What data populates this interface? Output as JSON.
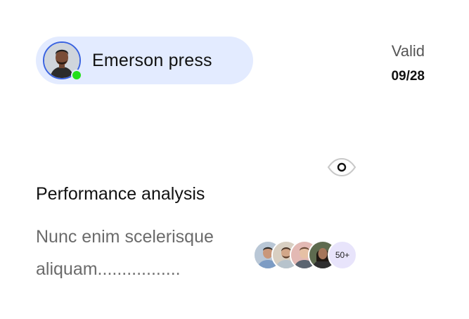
{
  "user": {
    "name": "Emerson press",
    "status": "online",
    "avatar_icon": "user-avatar"
  },
  "validity": {
    "label": "Valid",
    "date": "09/28"
  },
  "card": {
    "title": "Performance analysis",
    "description": "Nunc enim scelerisque aliquam................."
  },
  "participants": {
    "avatars": [
      "participant-avatar",
      "participant-avatar",
      "participant-avatar",
      "participant-avatar"
    ],
    "more_label": "50+"
  },
  "icons": {
    "view": "eye-icon"
  },
  "colors": {
    "chip_background": "#e3ebff",
    "avatar_ring": "#3a63e0",
    "online": "#22e01a",
    "more_badge": "#e8e4fb"
  }
}
